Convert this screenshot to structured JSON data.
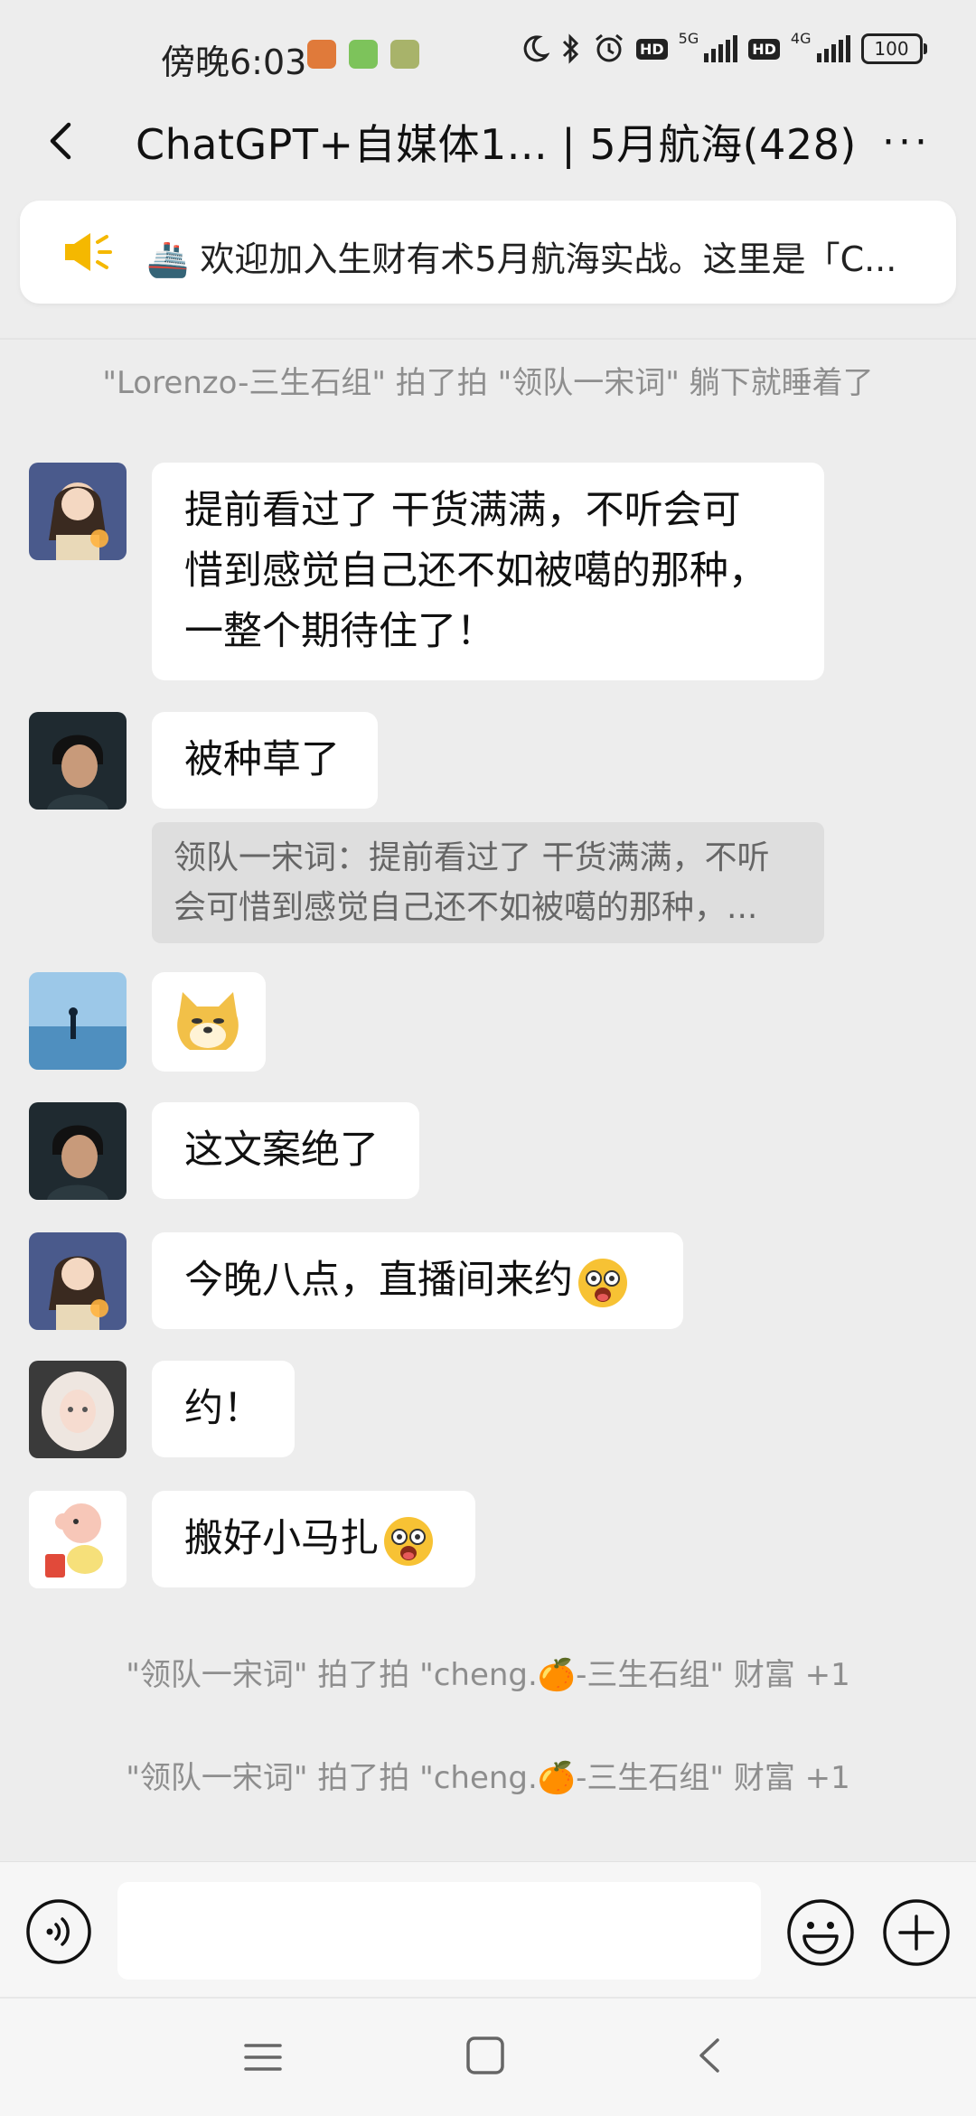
{
  "status_bar": {
    "time": "傍晚6:03",
    "net_5g": "5G",
    "net_4g": "4G",
    "hd": "HD",
    "battery": "100"
  },
  "header": {
    "title": "ChatGPT+自媒体1... | 5月航海(428)",
    "more_label": "···"
  },
  "notice": {
    "text": "🚢 欢迎加入生财有术5月航海实战。这里是「C..."
  },
  "system_messages": [
    "\"Lorenzo-三生石组\" 拍了拍 \"领队一宋词\" 躺下就睡着了",
    "\"领队一宋词\" 拍了拍 \"cheng.🍊-三生石组\" 财富 +1",
    "\"领队一宋词\" 拍了拍 \"cheng.🍊-三生石组\" 财富 +1"
  ],
  "messages": [
    {
      "line1": "提前看过了 干货满满，不听会可",
      "line2": "惜到感觉自己还不如被噶的那种，",
      "line3": "一整个期待住了！",
      "avatar": "girl-lantern"
    },
    {
      "text": "被种草了",
      "avatar": "boy-dark",
      "quote_line1": "领队一宋词：提前看过了 干货满满，不听",
      "quote_line2": "会可惜到感觉自己还不如被噶的那种，..."
    },
    {
      "sticker": "doge-sticker",
      "avatar": "sea-horizon"
    },
    {
      "text": "这文案绝了",
      "avatar": "boy-dark"
    },
    {
      "text": "今晚八点，直播间来约",
      "emoji": "starry-eyed",
      "avatar": "girl-lantern"
    },
    {
      "text": "约！",
      "avatar": "white-hair-girl"
    },
    {
      "text": "搬好小马扎",
      "emoji": "starry-eyed",
      "avatar": "cartoon-baby"
    }
  ],
  "input_bar": {
    "value": "",
    "placeholder": ""
  },
  "colors": {
    "background": "#ededed",
    "bubble": "#ffffff",
    "system_text": "#8e8e8e",
    "notice_icon": "#f5b800"
  }
}
